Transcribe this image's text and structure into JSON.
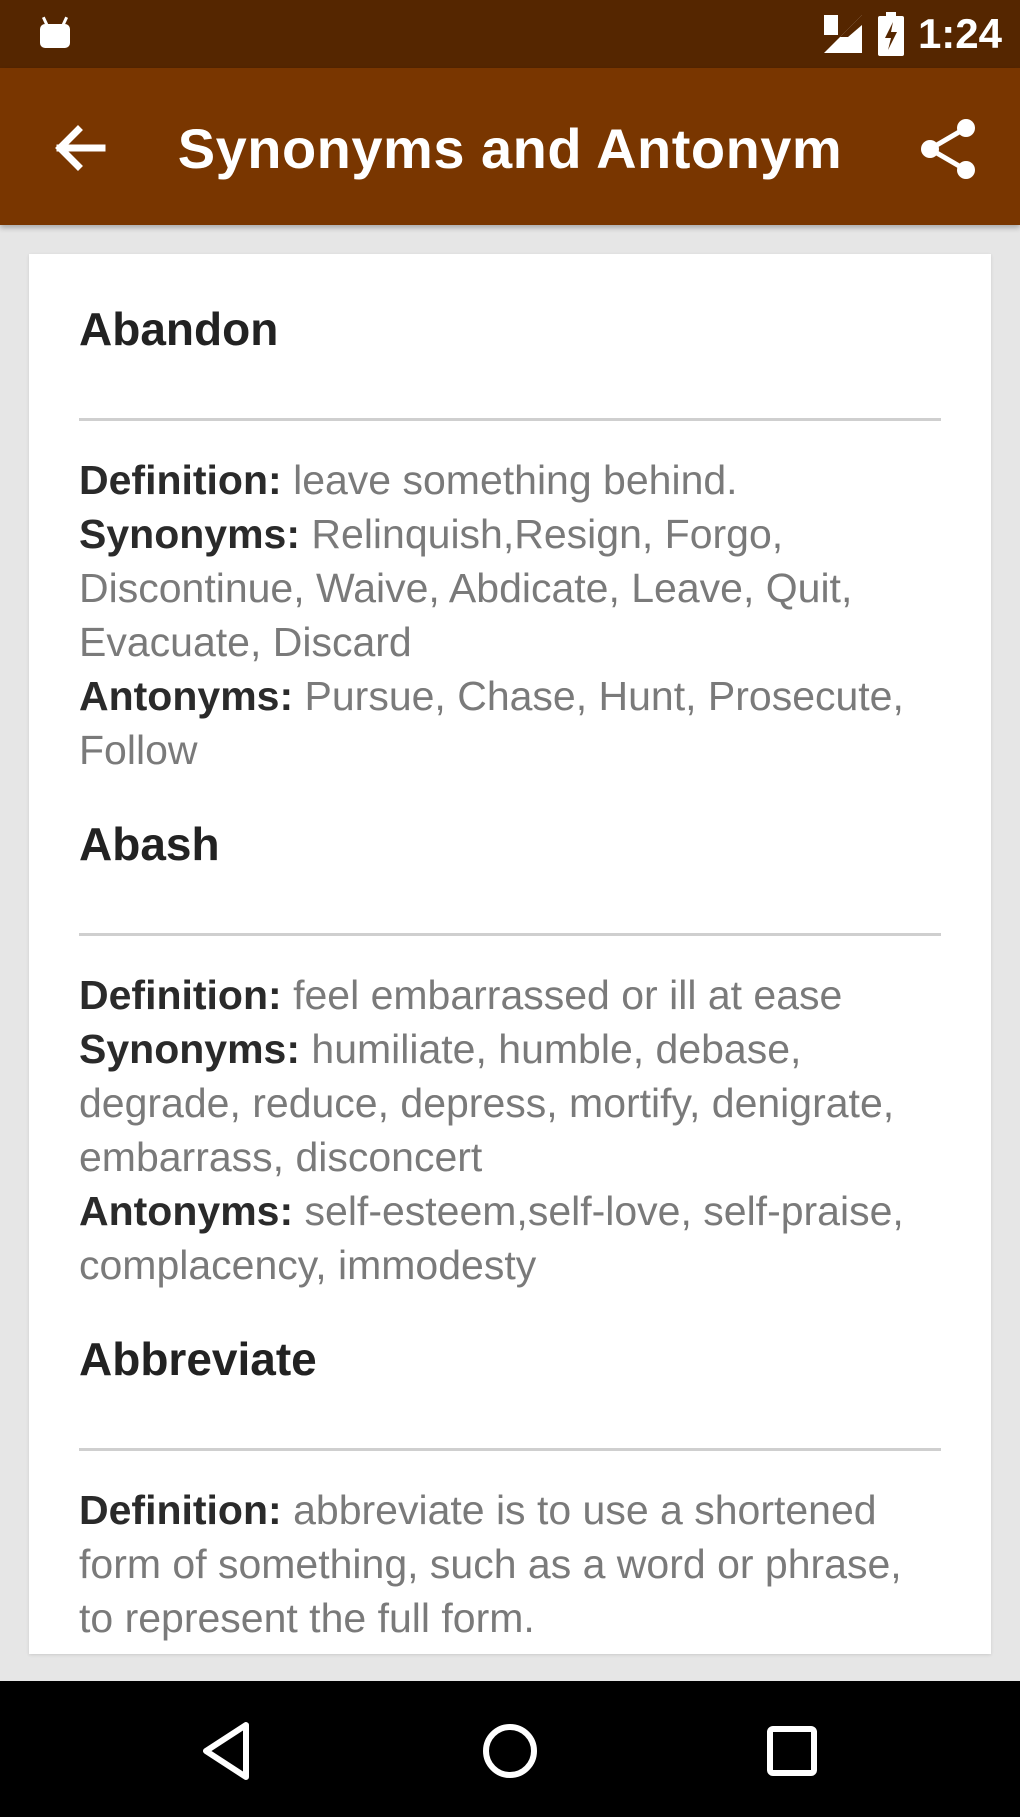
{
  "status_bar": {
    "time": "1:24",
    "icons": {
      "app": "android-icon",
      "signal": "signal-icon",
      "battery": "battery-charging-icon"
    }
  },
  "toolbar": {
    "title": "Synonyms and Antonym",
    "icons": {
      "back": "arrow-back-icon",
      "share": "share-icon"
    }
  },
  "labels": {
    "definition": "Definition:",
    "synonyms": "Synonyms:",
    "antonyms": "Antonyms:"
  },
  "entries": [
    {
      "word": "Abandon",
      "definition": "leave something behind.",
      "synonyms": "Relinquish,Resign, Forgo, Discontinue, Waive, Abdicate, Leave, Quit, Evacuate, Discard",
      "antonyms": "Pursue, Chase, Hunt, Prosecute, Follow"
    },
    {
      "word": "Abash",
      "definition": "feel embarrassed or ill at ease",
      "synonyms": "humiliate, humble, debase, degrade, reduce, depress, mortify, denigrate, embarrass, disconcert",
      "antonyms": "self-esteem,self-love, self-praise, complacency, immodesty"
    },
    {
      "word": "Abbreviate",
      "definition": "abbreviate is to use a shortened form of something, such as a word or phrase, to represent the full form."
    }
  ],
  "nav_bar": {
    "icons": {
      "back": "triangle-back-icon",
      "home": "circle-home-icon",
      "recents": "square-recents-icon"
    }
  },
  "colors": {
    "status_bar": "#552600",
    "toolbar": "#793600",
    "background": "#e6e6e6",
    "card": "#ffffff",
    "body_text": "#7a7a7a",
    "label_text": "#2a2a2a"
  }
}
